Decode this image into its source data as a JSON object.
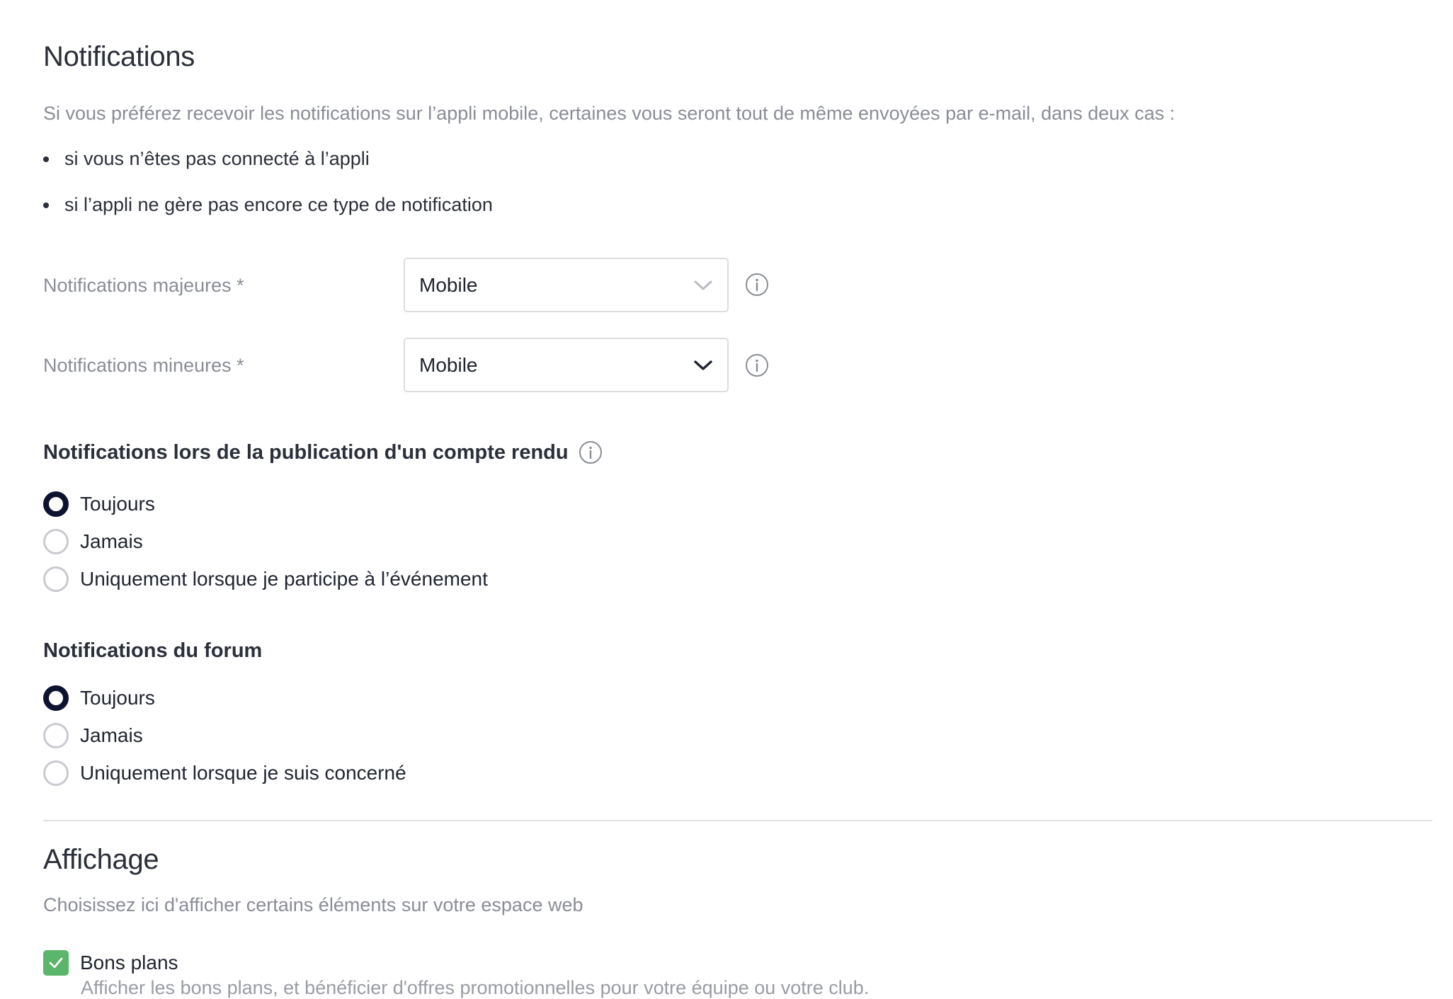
{
  "notifications": {
    "title": "Notifications",
    "description": "Si vous préférez recevoir les notifications sur l’appli mobile, certaines vous seront tout de même envoyées par e-mail, dans deux cas :",
    "bullets": [
      "si vous n’êtes pas connecté à l’appli",
      "si l’appli ne gère pas encore ce type de notification"
    ],
    "major": {
      "label": "Notifications majeures *",
      "value": "Mobile"
    },
    "minor": {
      "label": "Notifications mineures *",
      "value": "Mobile"
    }
  },
  "report": {
    "title": "Notifications lors de la publication d'un compte rendu",
    "options": [
      "Toujours",
      "Jamais",
      "Uniquement lorsque je participe à l’événement"
    ],
    "selected_index": 0
  },
  "forum": {
    "title": "Notifications du forum",
    "options": [
      "Toujours",
      "Jamais",
      "Uniquement lorsque je suis concerné"
    ],
    "selected_index": 0
  },
  "display": {
    "title": "Affichage",
    "description": "Choisissez ici d'afficher certains éléments sur votre espace web",
    "deals": {
      "label": "Bons plans",
      "description": "Afficher les bons plans, et bénéficier d'offres promotionnelles pour votre équipe ou votre club.",
      "checked": true
    }
  },
  "colors": {
    "accent": "#0c1230",
    "checkbox": "#5bb56a",
    "muted_text": "#8a8d96"
  }
}
